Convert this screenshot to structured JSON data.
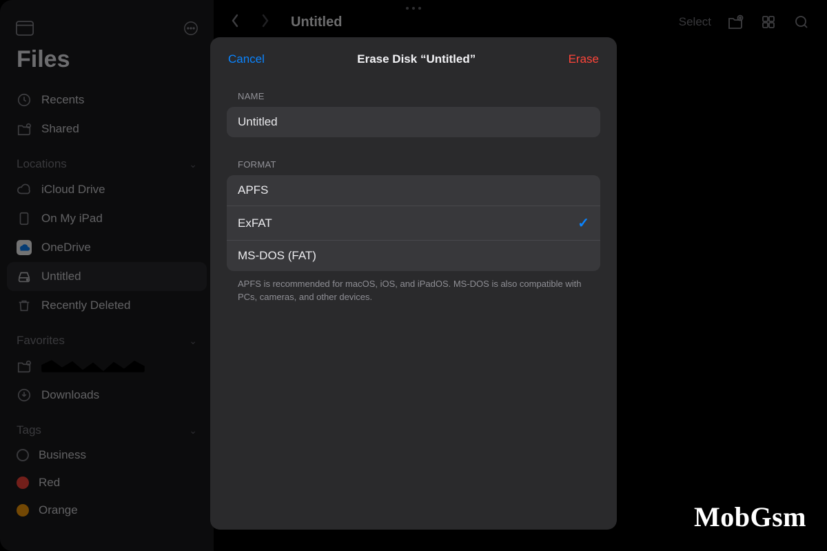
{
  "sidebar": {
    "app_title": "Files",
    "quick": [
      {
        "label": "Recents",
        "icon": "clock-icon"
      },
      {
        "label": "Shared",
        "icon": "folder-shared-icon"
      }
    ],
    "sections": {
      "locations_label": "Locations",
      "favorites_label": "Favorites",
      "tags_label": "Tags"
    },
    "locations": [
      {
        "label": "iCloud Drive",
        "icon": "cloud-icon"
      },
      {
        "label": "On My iPad",
        "icon": "ipad-icon"
      },
      {
        "label": "OneDrive",
        "icon": "onedrive-icon"
      },
      {
        "label": "Untitled",
        "icon": "drive-icon",
        "active": true
      },
      {
        "label": "Recently Deleted",
        "icon": "trash-icon"
      }
    ],
    "favorites": [
      {
        "label": "",
        "icon": "folder-shared-icon",
        "redacted": true
      },
      {
        "label": "Downloads",
        "icon": "download-icon"
      }
    ],
    "tags": [
      {
        "label": "Business",
        "color": ""
      },
      {
        "label": "Red",
        "color": "red"
      },
      {
        "label": "Orange",
        "color": "orange"
      }
    ]
  },
  "header": {
    "title": "Untitled",
    "select_label": "Select"
  },
  "modal": {
    "cancel_label": "Cancel",
    "title": "Erase Disk “Untitled”",
    "erase_label": "Erase",
    "name_section_label": "NAME",
    "name_value": "Untitled",
    "format_section_label": "FORMAT",
    "formats": [
      {
        "label": "APFS",
        "selected": false
      },
      {
        "label": "ExFAT",
        "selected": true
      },
      {
        "label": "MS-DOS (FAT)",
        "selected": false
      }
    ],
    "hint": "APFS is recommended for macOS, iOS, and iPadOS. MS-DOS is also compatible with PCs, cameras, and other devices."
  },
  "watermark": "MobGsm"
}
